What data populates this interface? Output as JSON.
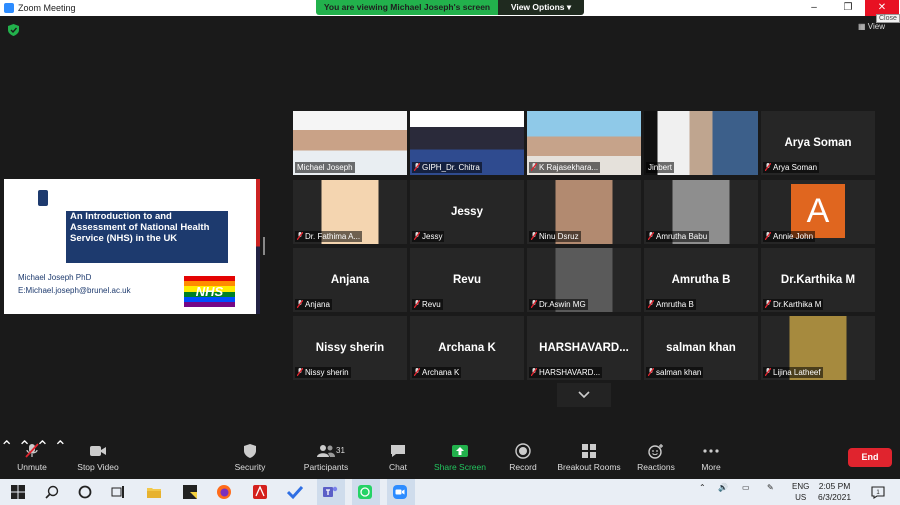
{
  "window": {
    "title": "Zoom Meeting",
    "close_tooltip": "Close",
    "banner_message": "You are viewing Michael Joseph's screen",
    "view_options_label": "View Options ▾",
    "view_label": "View"
  },
  "shared_slide": {
    "university_logo": "Brunel University London",
    "title": "An Introduction to and Assessment of  National Health Service (NHS)  in the UK",
    "author": "Michael Joseph PhD",
    "email": "E:Michael.joseph@brunel.ac.uk",
    "nhs_logo": "NHS"
  },
  "participants": [
    {
      "name": "Michael Joseph",
      "video": true,
      "muted": false,
      "active_speaker": true
    },
    {
      "name": "GIPH_Dr. Chitra",
      "video": true,
      "muted": true
    },
    {
      "name": "K Rajasekhara...",
      "video": true,
      "muted": true
    },
    {
      "name": "Jinbert",
      "video": true,
      "muted": false
    },
    {
      "name": "Arya Soman",
      "display": "Arya Soman",
      "video": false,
      "muted": true
    },
    {
      "name": "Dr. Fathima A...",
      "video": true,
      "muted": true
    },
    {
      "name": "Jessy",
      "display": "Jessy",
      "video": false,
      "muted": true
    },
    {
      "name": "Ninu Dsruz",
      "video": true,
      "muted": true
    },
    {
      "name": "Amrutha Babu",
      "video": true,
      "muted": true
    },
    {
      "name": "Annie John",
      "video": false,
      "muted": true,
      "avatar_letter": "A"
    },
    {
      "name": "Anjana",
      "display": "Anjana",
      "video": false,
      "muted": true
    },
    {
      "name": "Revu",
      "display": "Revu",
      "video": false,
      "muted": true
    },
    {
      "name": "Dr.Aswin MG",
      "video": true,
      "muted": true
    },
    {
      "name": "Amrutha B",
      "display": "Amrutha B",
      "video": false,
      "muted": true
    },
    {
      "name": "Dr.Karthika M",
      "display": "Dr.Karthika M",
      "video": false,
      "muted": true
    },
    {
      "name": "Nissy sherin",
      "display": "Nissy sherin",
      "video": false,
      "muted": true
    },
    {
      "name": "Archana K",
      "display": "Archana K",
      "video": false,
      "muted": true
    },
    {
      "name": "HARSHAVARD...",
      "display": "HARSHAVARD...",
      "video": false,
      "muted": true
    },
    {
      "name": "salman khan",
      "display": "salman khan",
      "video": false,
      "muted": true
    },
    {
      "name": "Lijina Latheef",
      "video": true,
      "muted": true
    }
  ],
  "toolbar": {
    "unmute": "Unmute",
    "stop_video": "Stop Video",
    "security": "Security",
    "participants": "Participants",
    "participants_count": "31",
    "chat": "Chat",
    "share_screen": "Share Screen",
    "record": "Record",
    "breakout_rooms": "Breakout Rooms",
    "reactions": "Reactions",
    "more": "More",
    "end": "End"
  },
  "taskbar": {
    "lang_top": "ENG",
    "lang_bottom": "US",
    "time": "2:05 PM",
    "date": "6/3/2021",
    "notification_count": "1"
  },
  "colors": {
    "accent_green": "#22b14c",
    "active_speaker_border": "#b7e23f",
    "end_red": "#e0242e",
    "mute_red": "#e0242e",
    "slide_blue": "#1d3a6e"
  }
}
